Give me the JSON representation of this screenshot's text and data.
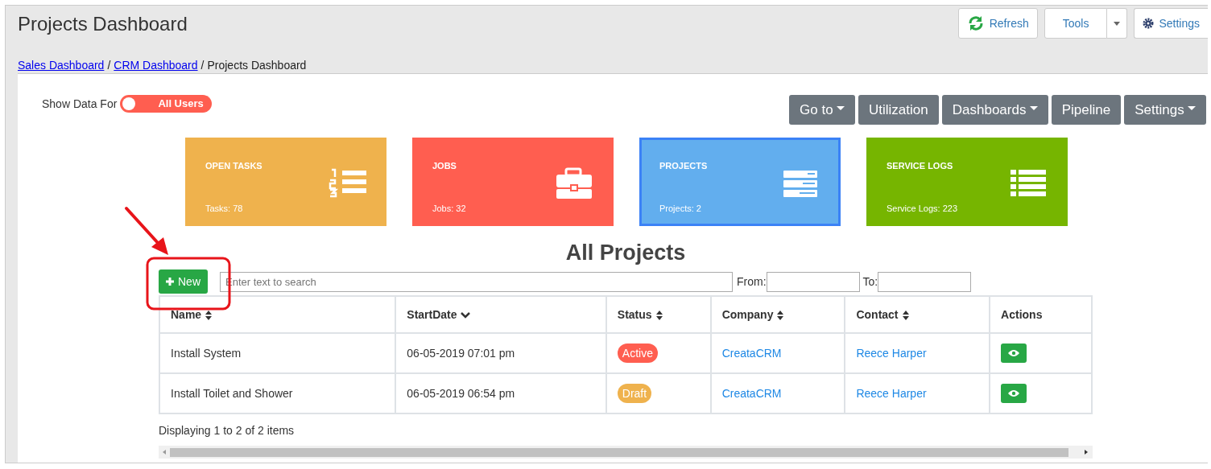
{
  "page_title": "Projects Dashboard",
  "top_buttons": [
    {
      "kind": "refresh",
      "label": "Refresh"
    },
    {
      "kind": "split",
      "label": "Tools"
    },
    {
      "kind": "settings",
      "label": "Settings"
    }
  ],
  "breadcrumb": [
    {
      "kind": "link",
      "label": "Sales Dashboard"
    },
    {
      "kind": "separator",
      "label": "/"
    },
    {
      "kind": "link",
      "label": "CRM Dashboard"
    },
    {
      "kind": "separator",
      "label": "/"
    },
    {
      "kind": "current",
      "label": "Projects Dashboard"
    }
  ],
  "show_data": {
    "label": "Show Data For",
    "toggle": {
      "label": "All Users",
      "on": false
    }
  },
  "nav_buttons": [
    {
      "label": "Go to",
      "dropdown": true
    },
    {
      "label": "Utilization",
      "dropdown": false
    },
    {
      "label": "Dashboards",
      "dropdown": true
    },
    {
      "label": "Pipeline",
      "dropdown": false
    },
    {
      "label": "Settings",
      "dropdown": true
    }
  ],
  "tiles": [
    {
      "kind": "tasks",
      "title": "OPEN TASKS",
      "count": "Tasks: 78",
      "color": "#efb24d",
      "selected": false
    },
    {
      "kind": "jobs",
      "title": "JOBS",
      "count": "Jobs: 32",
      "color": "#ff5e50",
      "selected": false
    },
    {
      "kind": "projects",
      "title": "PROJECTS",
      "count": "Projects: 2",
      "color": "#62aeee",
      "selected": true
    },
    {
      "kind": "logs",
      "title": "SERVICE LOGS",
      "count": "Service Logs: 223",
      "color": "#76b500",
      "selected": false
    }
  ],
  "section_title": "All Projects",
  "new_button": "New",
  "search": {
    "placeholder": "Enter text to search"
  },
  "from_label": "From:",
  "to_label": "To:",
  "table": {
    "columns": [
      {
        "label": "Name",
        "sortable": true,
        "sorted_desc": false
      },
      {
        "label": "StartDate",
        "sortable": true,
        "sorted_desc": true
      },
      {
        "label": "Status",
        "sortable": true,
        "sorted_desc": false
      },
      {
        "label": "Company",
        "sortable": true,
        "sorted_desc": false
      },
      {
        "label": "Contact",
        "sortable": true,
        "sorted_desc": false
      },
      {
        "label": "Actions",
        "sortable": false
      }
    ],
    "rows": [
      {
        "name": "Install System",
        "start": "06-05-2019 07:01 pm",
        "status": {
          "label": "Active",
          "color": "#ff5e50"
        },
        "company": "CreataCRM",
        "contact": "Reece Harper"
      },
      {
        "name": "Install Toilet and Shower",
        "start": "06-05-2019 06:54 pm",
        "status": {
          "label": "Draft",
          "color": "#efb24d"
        },
        "company": "CreataCRM",
        "contact": "Reece Harper"
      }
    ]
  },
  "footer": "Displaying 1 to 2 of 2 items"
}
